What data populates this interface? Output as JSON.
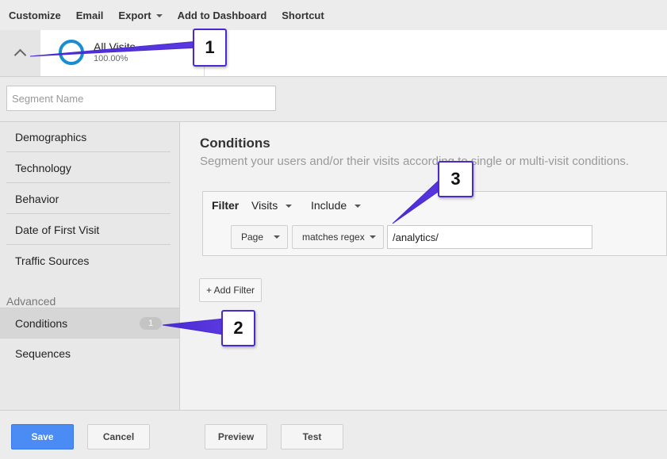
{
  "toolbar": {
    "customize": "Customize",
    "email": "Email",
    "export": "Export",
    "add_to_dashboard": "Add to Dashboard",
    "shortcut": "Shortcut"
  },
  "segment": {
    "name": "All Visits",
    "percent": "100.00%"
  },
  "segment_name_input": {
    "placeholder": "Segment Name",
    "value": ""
  },
  "leftnav": {
    "items": [
      "Demographics",
      "Technology",
      "Behavior",
      "Date of First Visit",
      "Traffic Sources"
    ],
    "advanced_label": "Advanced",
    "conditions": "Conditions",
    "conditions_count": "1",
    "sequences": "Sequences"
  },
  "conditions": {
    "title": "Conditions",
    "subtitle": "Segment your users and/or their visits according to single or multi-visit conditions."
  },
  "filter": {
    "label": "Filter",
    "scope": "Visits",
    "mode": "Include",
    "dimension": "Page",
    "operator": "matches regex",
    "value": "/analytics/"
  },
  "add_filter_label": "+ Add Filter",
  "footer": {
    "save": "Save",
    "cancel": "Cancel",
    "preview": "Preview",
    "test": "Test"
  },
  "callouts": [
    "1",
    "2",
    "3"
  ],
  "colors": {
    "primary_button": "#4b8bf4",
    "callout_border": "#4a2ad0",
    "segment_ring": "#1a8cd2"
  }
}
